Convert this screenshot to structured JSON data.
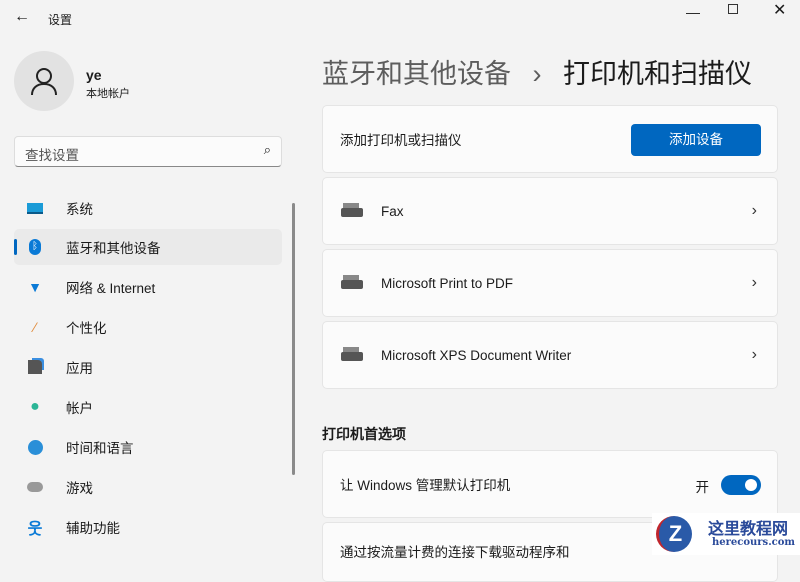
{
  "window": {
    "title": "设置"
  },
  "user": {
    "name": "ye",
    "type": "本地帐户"
  },
  "search": {
    "placeholder": "查找设置"
  },
  "sidebar": {
    "items": [
      {
        "label": "系统",
        "icon": "monitor-icon"
      },
      {
        "label": "蓝牙和其他设备",
        "icon": "bluetooth-icon"
      },
      {
        "label": "网络 & Internet",
        "icon": "wifi-icon"
      },
      {
        "label": "个性化",
        "icon": "brush-icon"
      },
      {
        "label": "应用",
        "icon": "apps-icon"
      },
      {
        "label": "帐户",
        "icon": "account-icon"
      },
      {
        "label": "时间和语言",
        "icon": "clock-icon"
      },
      {
        "label": "游戏",
        "icon": "gamepad-icon"
      },
      {
        "label": "辅助功能",
        "icon": "accessibility-icon"
      }
    ]
  },
  "breadcrumb": {
    "parent": "蓝牙和其他设备",
    "sep": "›",
    "current": "打印机和扫描仪"
  },
  "add": {
    "label": "添加打印机或扫描仪",
    "button": "添加设备"
  },
  "printers": [
    "Fax",
    "Microsoft Print to PDF",
    "Microsoft XPS Document Writer"
  ],
  "prefs": {
    "heading": "打印机首选项",
    "manage_default": "让 Windows 管理默认打印机",
    "toggle_state": "开",
    "toggle_on": true,
    "metered": "通过按流量计费的连接下载驱动程序和"
  },
  "watermark": {
    "name": "这里教程网",
    "url": "herecours.com"
  },
  "colors": {
    "accent": "#0067c0"
  }
}
